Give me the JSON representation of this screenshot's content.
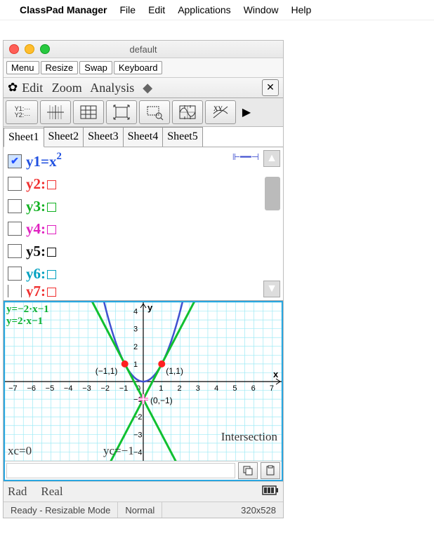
{
  "mac_menu": {
    "app": "ClassPad Manager",
    "items": [
      "File",
      "Edit",
      "Applications",
      "Window",
      "Help"
    ]
  },
  "window": {
    "title": "default",
    "buttons": [
      "Menu",
      "Resize",
      "Swap",
      "Keyboard"
    ]
  },
  "app_toolbar": {
    "menus": [
      "Edit",
      "Zoom",
      "Analysis"
    ]
  },
  "iconbar": {
    "items": [
      "y-editor",
      "graph-axes",
      "table",
      "fit",
      "zoom-box",
      "trig-fit",
      "xy-swap"
    ]
  },
  "sheets": [
    "Sheet1",
    "Sheet2",
    "Sheet3",
    "Sheet4",
    "Sheet5"
  ],
  "functions": [
    {
      "name": "y1",
      "enabled": true,
      "color": "c-blue",
      "expr_html": "y1=<sub style='color:#2050e0'>x</sub><sup>2</sup>"
    },
    {
      "name": "y2",
      "enabled": false,
      "color": "c-red",
      "label": "y2:"
    },
    {
      "name": "y3",
      "enabled": false,
      "color": "c-green",
      "label": "y3:"
    },
    {
      "name": "y4",
      "enabled": false,
      "color": "c-mag",
      "label": "y4:"
    },
    {
      "name": "y5",
      "enabled": false,
      "color": "c-black",
      "label": "y5:"
    },
    {
      "name": "y6",
      "enabled": false,
      "color": "c-cyan",
      "label": "y6:"
    },
    {
      "name": "y7",
      "enabled": false,
      "color": "c-red",
      "label": "y7:"
    }
  ],
  "graph": {
    "eq1": "y=−2·x−1",
    "eq2": "y=2·x−1",
    "pt1": "(−1,1)",
    "pt2": "(1,1)",
    "pt3": "(0,−1)",
    "mode": "Intersection",
    "xc": "xc=0",
    "yc": "yc=−1",
    "xticks": [
      -7,
      -6,
      -5,
      -4,
      -3,
      -2,
      -1,
      0,
      1,
      2,
      3,
      4,
      5,
      6,
      7
    ],
    "yticks": [
      -4,
      -3,
      -2,
      -1,
      1,
      2,
      3,
      4
    ],
    "yaxis_label": "y",
    "xaxis_label": "x"
  },
  "chart_data": {
    "type": "line",
    "title": "",
    "xlabel": "x",
    "ylabel": "y",
    "xlim": [
      -7.5,
      7.5
    ],
    "ylim": [
      -4.5,
      4.5
    ],
    "series": [
      {
        "name": "y=x^2",
        "color": "#4050d0",
        "type": "curve",
        "formula": "x*x"
      },
      {
        "name": "y=-2x-1",
        "color": "#10c030",
        "type": "line",
        "points": [
          [
            -3,
            5
          ],
          [
            2,
            -5
          ]
        ]
      },
      {
        "name": "y=2x-1",
        "color": "#10c030",
        "type": "line",
        "points": [
          [
            -2,
            -5
          ],
          [
            3,
            5
          ]
        ]
      }
    ],
    "markers": [
      {
        "x": -1,
        "y": 1,
        "label": "(-1,1)",
        "color": "#ff2020"
      },
      {
        "x": 1,
        "y": 1,
        "label": "(1,1)",
        "color": "#ff2020"
      },
      {
        "x": 0,
        "y": -1,
        "label": "(0,-1)",
        "color": "#ff60c0",
        "shape": "plus"
      }
    ],
    "annotations": [
      "Intersection",
      "xc=0",
      "yc=-1"
    ]
  },
  "mode": {
    "angle": "Rad",
    "number": "Real"
  },
  "status": {
    "left": "Ready - Resizable Mode",
    "mid": "Normal",
    "right": "320x528"
  }
}
